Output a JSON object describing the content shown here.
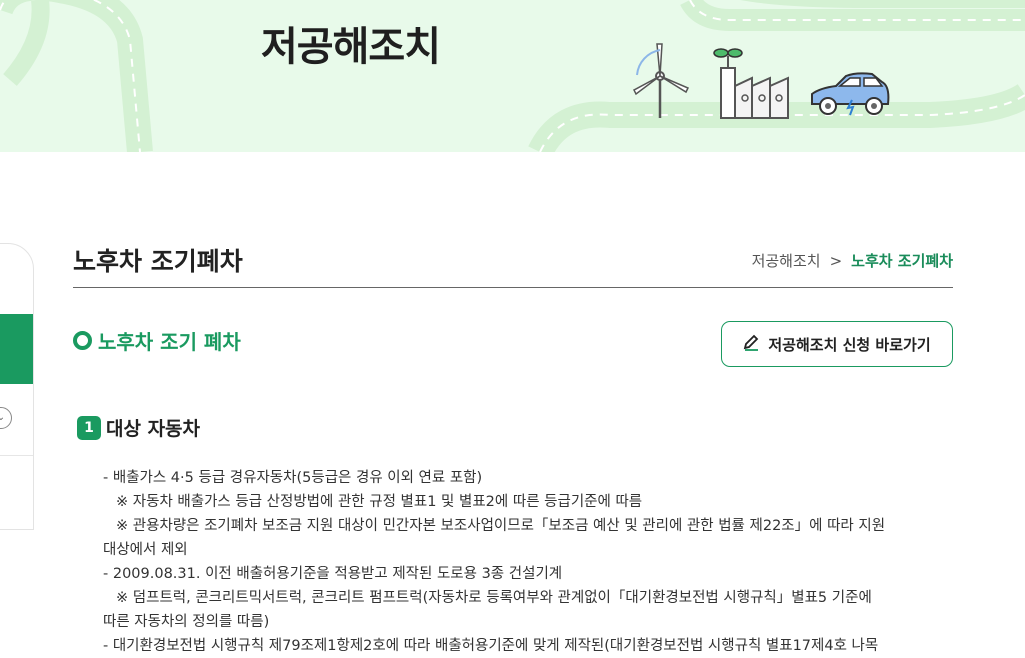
{
  "banner": {
    "title": "저공해조치"
  },
  "sidebar": {
    "expand_icon": "chevron-down-icon"
  },
  "header": {
    "title": "노후차 조기폐차",
    "breadcrumb": {
      "parent": "저공해조치",
      "separator": ">",
      "current": "노후차 조기폐차"
    }
  },
  "section": {
    "title": "노후차 조기 폐차",
    "apply_button": "저공해조치 신청 바로가기"
  },
  "subsection": {
    "number": "1",
    "title": "대상 자동차"
  },
  "content": {
    "line1": "- 배출가스 4·5 등급 경유자동차(5등급은 경유 이외 연료 포함)",
    "line2": "※ 자동차 배출가스 등급 산정방법에 관한 규정 별표1 및 별표2에 따른 등급기준에 따름",
    "line3a": "※ 관용차량은 조기폐차 보조금 지원 대상이 민간자본 보조사업이므로「보조금 예산 및 관리에 관한 법률 제22조」에 따라 지원",
    "line3b": "대상에서 제외",
    "line4": "- 2009.08.31. 이전 배출허용기준을 적용받고 제작된 도로용 3종 건설기계",
    "line5a": "※ 덤프트럭, 콘크리트믹서트럭, 콘크리트 펌프트럭(자동차로 등록여부와 관계없이「대기환경보전법 시행규칙」별표5 기준에",
    "line5b": "따른 자동차의 정의를 따름)",
    "line6": "- 대기환경보전법 시행규칙 제79조제1항제2호에 따라 배출허용기준에 맞게 제작된(대기환경보전법 시행규칙 별표17제4호 나목"
  },
  "colors": {
    "accent": "#1a9a60",
    "banner_bg": "#e8faea"
  }
}
